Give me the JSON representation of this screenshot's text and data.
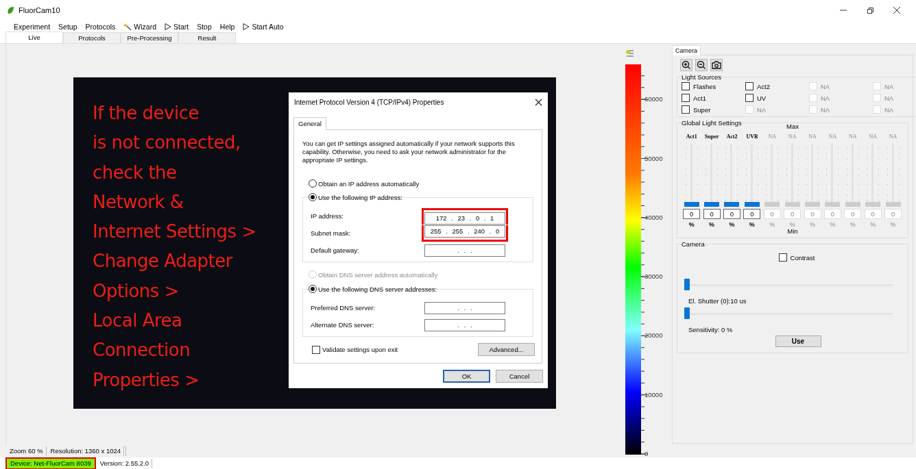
{
  "window": {
    "title": "FluorCam10"
  },
  "menu": [
    {
      "label": "Experiment",
      "kind": "plain"
    },
    {
      "label": "Setup",
      "kind": "plain"
    },
    {
      "label": "Protocols",
      "kind": "plain"
    },
    {
      "label": "Wizard",
      "kind": "wizard"
    },
    {
      "label": "Start",
      "kind": "play"
    },
    {
      "label": "Stop",
      "kind": "plain"
    },
    {
      "label": "Help",
      "kind": "plain"
    },
    {
      "label": "Start Auto",
      "kind": "play"
    }
  ],
  "tabs": [
    {
      "label": "Live",
      "selected": true
    },
    {
      "label": "Protocols",
      "selected": false
    },
    {
      "label": "Pre-Processing",
      "selected": false
    },
    {
      "label": "Result",
      "selected": false
    }
  ],
  "image": {
    "instruction": "If the device\nis not connected,\ncheck the\nNetwork &\nInternet Settings >\nChange Adapter\nOptions >\nLocal Area\nConnection\nProperties >"
  },
  "dialog": {
    "title": "Internet Protocol Version 4 (TCP/IPv4) Properties",
    "tab": "General",
    "description": "You can get IP settings assigned automatically if your network supports this capability. Otherwise, you need to ask your network administrator for the appropriate IP settings.",
    "ip_auto": {
      "label": "Obtain an IP address automatically",
      "selected": false,
      "disabled": false
    },
    "ip_manual": {
      "label": "Use the following IP address:",
      "selected": true,
      "disabled": false
    },
    "ip_fields": [
      {
        "label": "IP address:",
        "value": "172 . 23 . 0 . 1",
        "highlighted": true
      },
      {
        "label": "Subnet mask:",
        "value": "255 . 255 . 240 . 0",
        "highlighted": true
      },
      {
        "label": "Default gateway:",
        "value": ". . .",
        "highlighted": false
      }
    ],
    "dns_auto": {
      "label": "Obtain DNS server address automatically",
      "selected": false,
      "disabled": true
    },
    "dns_manual": {
      "label": "Use the following DNS server addresses:",
      "selected": true,
      "disabled": false
    },
    "dns_fields": [
      {
        "label": "Preferred DNS server:",
        "value": ". . .",
        "highlighted": false
      },
      {
        "label": "Alternate DNS server:",
        "value": ". . .",
        "highlighted": false
      }
    ],
    "validate": {
      "label": "Validate settings upon exit",
      "checked": false
    },
    "advanced_button": "Advanced...",
    "buttons": [
      {
        "label": "OK",
        "kind": "default"
      },
      {
        "label": "Cancel",
        "kind": "normal"
      }
    ]
  },
  "colorbar": {
    "ticks": [
      "60000",
      "50000",
      "40000",
      "30000",
      "20000",
      "10000",
      "0"
    ]
  },
  "panel": {
    "tab": "Camera",
    "light_sources": {
      "title": "Light Sources",
      "items": [
        {
          "label": "Flashes",
          "checked": false,
          "disabled": false
        },
        {
          "label": "Act2",
          "checked": false,
          "disabled": false
        },
        {
          "label": "NA",
          "checked": false,
          "disabled": true
        },
        {
          "label": "NA",
          "checked": false,
          "disabled": true
        },
        {
          "label": "Act1",
          "checked": false,
          "disabled": false
        },
        {
          "label": "UV",
          "checked": false,
          "disabled": false
        },
        {
          "label": "NA",
          "checked": false,
          "disabled": true
        },
        {
          "label": "NA",
          "checked": false,
          "disabled": true
        },
        {
          "label": "Super",
          "checked": false,
          "disabled": false
        },
        {
          "label": "NA",
          "checked": false,
          "disabled": true
        },
        {
          "label": "NA",
          "checked": false,
          "disabled": true
        },
        {
          "label": "NA",
          "checked": false,
          "disabled": true
        }
      ]
    },
    "global_light": {
      "title": "Global Light Settings",
      "max_label": "Max",
      "min_label": "Min",
      "channels": [
        {
          "name": "Act1",
          "level": 0,
          "value": "0",
          "unit": "%",
          "disabled": false
        },
        {
          "name": "Super",
          "level": 0,
          "value": "0",
          "unit": "%",
          "disabled": false
        },
        {
          "name": "Act2",
          "level": 0,
          "value": "0",
          "unit": "%",
          "disabled": false
        },
        {
          "name": "UVB",
          "level": 0,
          "value": "0",
          "unit": "%",
          "disabled": false
        },
        {
          "name": "NA",
          "level": 0,
          "value": "0",
          "unit": "%",
          "disabled": true
        },
        {
          "name": "NA",
          "level": 0,
          "value": "0",
          "unit": "%",
          "disabled": true
        },
        {
          "name": "NA",
          "level": 0,
          "value": "0",
          "unit": "%",
          "disabled": true
        },
        {
          "name": "NA",
          "level": 0,
          "value": "0",
          "unit": "%",
          "disabled": true
        },
        {
          "name": "NA",
          "level": 0,
          "value": "0",
          "unit": "%",
          "disabled": true
        },
        {
          "name": "NA",
          "level": 0,
          "value": "0",
          "unit": "%",
          "disabled": true
        },
        {
          "name": "NA",
          "level": 0,
          "value": "0",
          "unit": "%",
          "disabled": true
        }
      ]
    },
    "camera": {
      "title": "Camera",
      "contrast": {
        "label": "Contrast",
        "checked": false
      },
      "sliders": [
        {
          "label": "El. Shutter (0):10 us",
          "level": 0
        },
        {
          "label": "Sensitivity: 0 %",
          "level": 0
        }
      ],
      "use_button": "Use"
    }
  },
  "status_bar": [
    {
      "text": "Zoom 60 %"
    },
    {
      "text": "Resolution: 1360 x 1024"
    }
  ],
  "device_bar": [
    {
      "text": "Device: Net-FluorCam 8039",
      "highlighted": true
    },
    {
      "text": "Version: 2.55.2.0",
      "highlighted": false
    }
  ]
}
